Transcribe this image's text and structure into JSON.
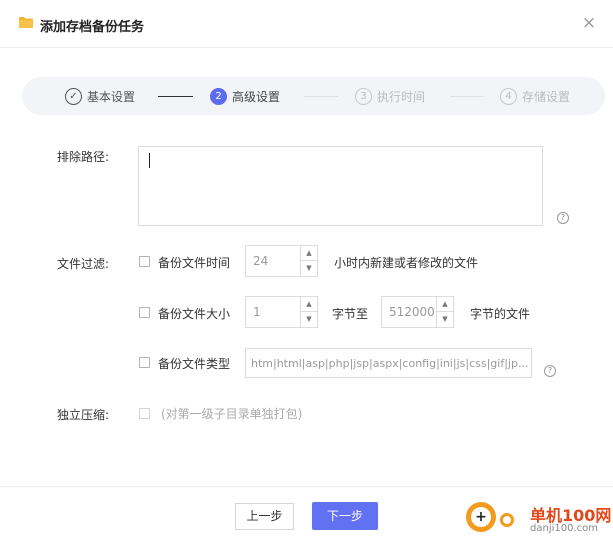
{
  "dialog": {
    "title": "添加存档备份任务",
    "close_symbol": "×"
  },
  "steps": [
    {
      "num": "✓",
      "label": "基本设置",
      "state": "done"
    },
    {
      "num": "2",
      "label": "高级设置",
      "state": "active"
    },
    {
      "num": "3",
      "label": "执行时间",
      "state": "pending"
    },
    {
      "num": "4",
      "label": "存储设置",
      "state": "pending"
    }
  ],
  "exclude": {
    "label": "排除路径:",
    "value": ""
  },
  "filter": {
    "label": "文件过滤:",
    "by_time": {
      "checkbox_label": "备份文件时间",
      "value": "24",
      "suffix": "小时内新建或者修改的文件",
      "checked": false
    },
    "by_size": {
      "checkbox_label": "备份文件大小",
      "min_value": "1",
      "between": "字节至",
      "max_value": "512000",
      "suffix": "字节的文件",
      "checked": false
    },
    "by_type": {
      "checkbox_label": "备份文件类型",
      "placeholder": "htm|html|asp|php|jsp|aspx|config|ini|js|css|gif|jp...",
      "checked": false
    }
  },
  "compress": {
    "label": "独立压缩:",
    "hint": "(对第一级子目录单独打包)",
    "checked": false
  },
  "footer": {
    "prev_label": "上一步",
    "next_label": "下一步"
  },
  "watermark": {
    "brand": "单机100网",
    "url": "danji100.com"
  },
  "icons": {
    "folder": "folder-icon",
    "help": "question-circle-icon",
    "close": "close-icon",
    "spin_up": "caret-up-icon",
    "spin_down": "caret-down-icon"
  },
  "colors": {
    "accent": "#5b6cf0",
    "primary_button": "#6270f2",
    "folder": "#f5b335"
  }
}
